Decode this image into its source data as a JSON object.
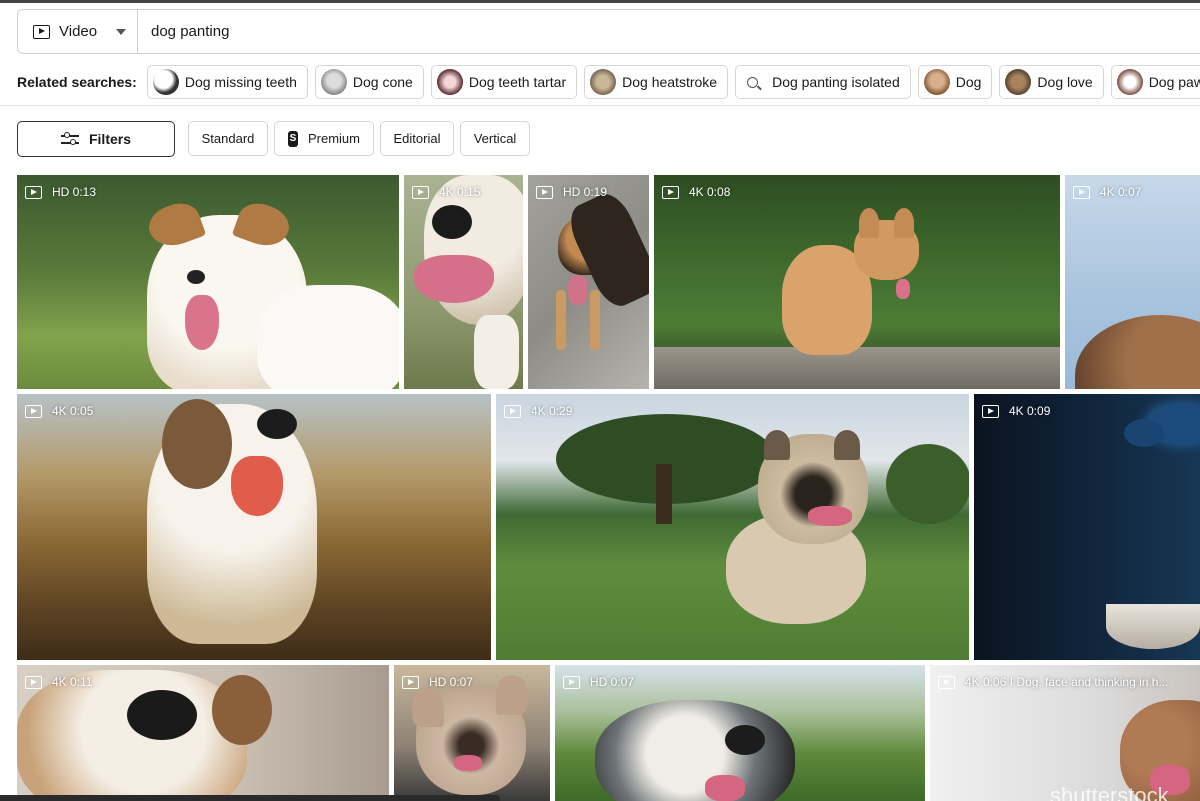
{
  "search": {
    "media_type": "Video",
    "query": "dog panting"
  },
  "related": {
    "label": "Related searches:",
    "items": [
      "Dog missing teeth",
      "Dog cone",
      "Dog teeth tartar",
      "Dog heatstroke",
      "Dog panting isolated",
      "Dog",
      "Dog love",
      "Dog paws"
    ]
  },
  "filters": {
    "button": "Filters",
    "chips": [
      "Standard",
      "Premium",
      "Editorial",
      "Vertical"
    ],
    "premium_badge": "S"
  },
  "results": [
    {
      "badge": "HD 0:13"
    },
    {
      "badge": "4K 0:15"
    },
    {
      "badge": "HD 0:19"
    },
    {
      "badge": "4K 0:08"
    },
    {
      "badge": "4K 0:07"
    },
    {
      "badge": "4K 0:05"
    },
    {
      "badge": "4K 0:29"
    },
    {
      "badge": "4K 0:09"
    },
    {
      "badge": "4K 0:11"
    },
    {
      "badge": "HD 0:07"
    },
    {
      "badge": "HD 0:07"
    },
    {
      "badge": "4K 0:06 I Dog, face and thinking in h..."
    }
  ],
  "watermark": "shutterstock"
}
